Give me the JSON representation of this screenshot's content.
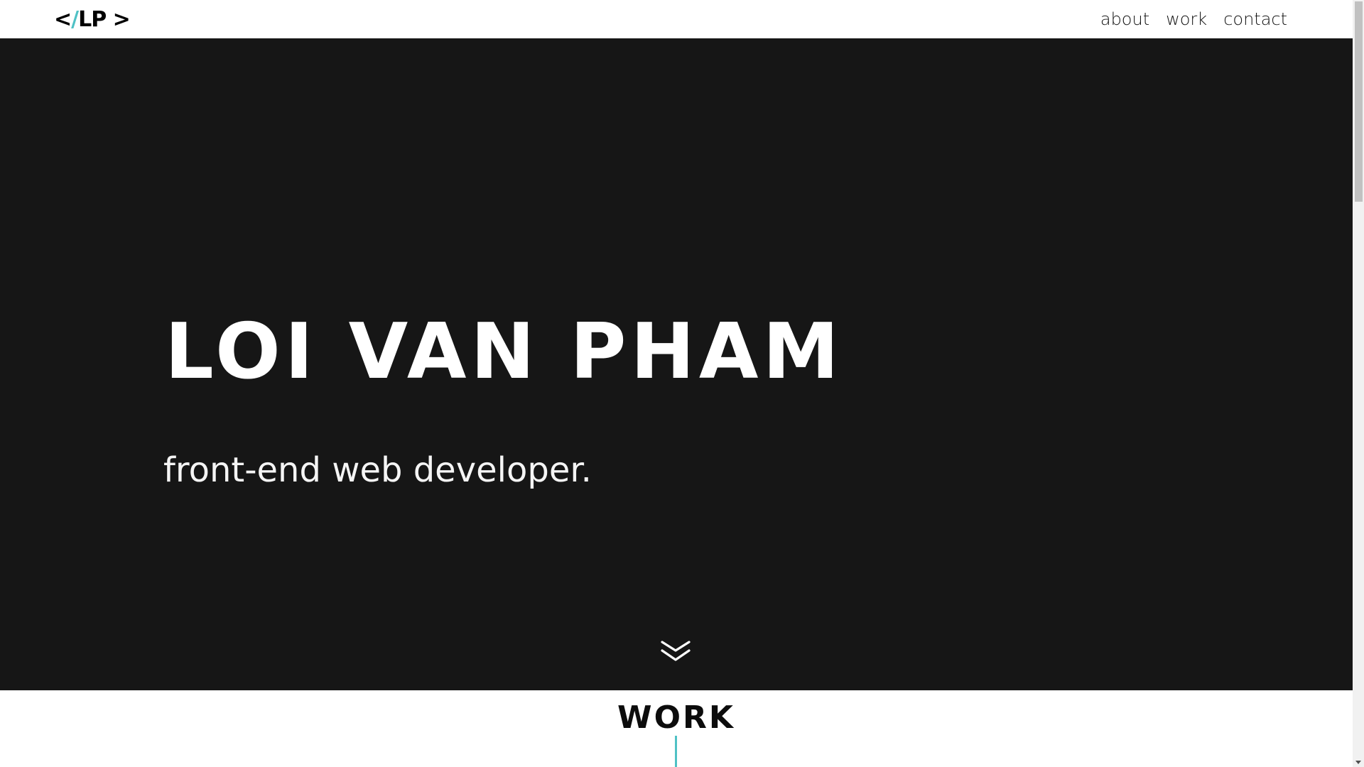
{
  "nav": {
    "logo": {
      "open": "<",
      "slash": "/",
      "initials": "LP",
      "close": " >"
    },
    "links": [
      {
        "label": "about"
      },
      {
        "label": "work"
      },
      {
        "label": "contact"
      }
    ]
  },
  "hero": {
    "name": "LOI VAN PHAM",
    "subtitle": "front-end web developer.",
    "scroll_icon": "double-chevron-down-icon"
  },
  "work": {
    "title": "WORK"
  },
  "colors": {
    "accent": "#4fc1c5",
    "hero_bg": "#161616",
    "text_dark": "#0c0c0c",
    "text_light": "#ffffff"
  }
}
